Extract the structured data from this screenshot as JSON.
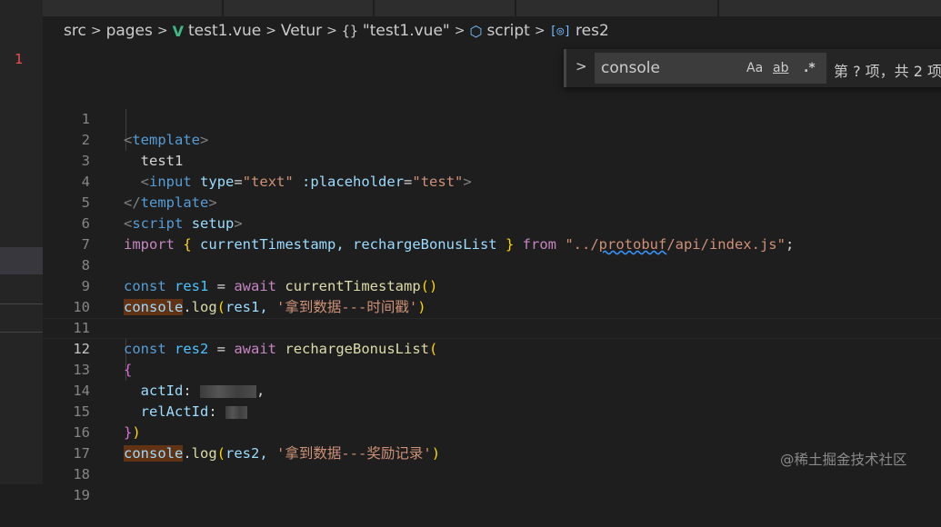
{
  "explorer": {
    "problem_count": "1"
  },
  "breadcrumb": {
    "items": [
      "src",
      "pages",
      "test1.vue",
      "Vetur",
      "\"test1.vue\"",
      "script",
      "res2"
    ],
    "icons": [
      "vue-icon",
      "braces-icon",
      "cube-icon",
      "variable-icon"
    ]
  },
  "find_widget": {
    "query": "console",
    "match_case_label": "Aa",
    "whole_word_label": "ab",
    "regex_label": ".*",
    "result_text": "第 ? 项，共 2 项"
  },
  "editor": {
    "current_line": 12,
    "line_numbers": [
      "1",
      "2",
      "3",
      "4",
      "5",
      "6",
      "7",
      "8",
      "9",
      "10",
      "11",
      "12",
      "13",
      "14",
      "15",
      "16",
      "17",
      "18",
      "19"
    ],
    "lines": [
      {
        "t_open": "<",
        "name": "template",
        "t_close": ">"
      },
      {
        "text": "test1"
      },
      {
        "t_open": "<",
        "name": "input",
        "attr1": "type",
        "eq1": "=",
        "val1": "\"text\"",
        "attr2": ":placeholder",
        "eq2": "=",
        "val2": "\"test\"",
        "t_close": ">"
      },
      {
        "t_open": "</",
        "name": "template",
        "t_close": ">"
      },
      {
        "t_open": "<",
        "name": "script",
        "attr": "setup",
        "t_close": ">"
      },
      {
        "kw": "import",
        "b_open": "{",
        "body": " currentTimestamp, rechargeBonusList ",
        "b_close": "}",
        "from": "from",
        "q_open": "\"../",
        "squig": "protobuf",
        "q_rest": "/api/index.js\"",
        "end": ";"
      },
      {},
      {
        "decl": "const",
        "var": "res1",
        "op": " = ",
        "kw": "await",
        "fn": "currentTimestamp",
        "parens": "()"
      },
      {
        "obj": "console",
        "dot": ".",
        "fn": "log",
        "p_open": "(",
        "arg": "res1, ",
        "str": "'拿到数据---时间戳'",
        "p_close": ")"
      },
      {},
      {
        "decl": "const",
        "var": "res2",
        "op": " = ",
        "kw": "await",
        "fn": "rechargeBonusList",
        "p_open": "("
      },
      {
        "b_open": "{"
      },
      {
        "prop": "actId",
        "colon": ":",
        "tail": ","
      },
      {
        "prop": "relActId",
        "colon": ":"
      },
      {
        "b_close": "}",
        "p_close": ")"
      },
      {
        "obj": "console",
        "dot": ".",
        "fn": "log",
        "p_open": "(",
        "arg": "res2, ",
        "str": "'拿到数据---奖励记录'",
        "p_close": ")"
      },
      {},
      {},
      {}
    ]
  },
  "watermark": "@稀土掘金技术社区"
}
